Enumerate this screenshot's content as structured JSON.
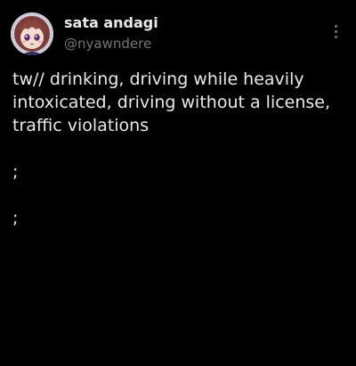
{
  "author": {
    "display_name": "sata andagi",
    "handle": "@nyawndere",
    "avatar_icon": "anime-avatar"
  },
  "menu": {
    "icon": "more-vertical-icon"
  },
  "post": {
    "text_lines": [
      "tw// drinking, driving while heavily",
      "intoxicated, driving without a license,",
      "traffic violations"
    ],
    "extra_lines": [
      ";",
      ";"
    ]
  },
  "colors": {
    "background": "#000000",
    "text": "#e7e9ea",
    "secondary_text": "#71767b"
  }
}
